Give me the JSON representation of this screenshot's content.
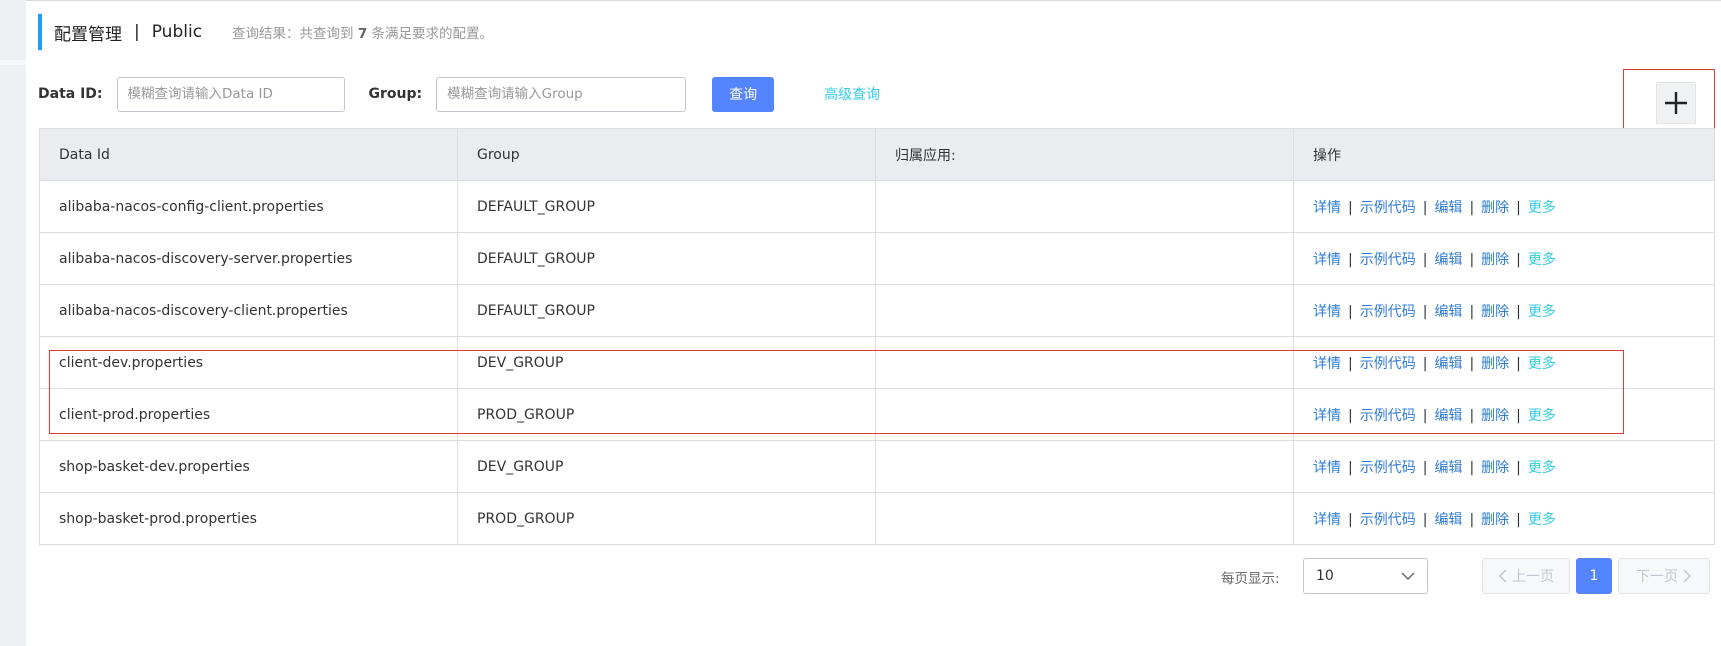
{
  "header": {
    "title": "配置管理",
    "separator": "|",
    "namespace": "Public",
    "result_prefix": "查询结果：共查询到",
    "result_count": "7",
    "result_suffix": "条满足要求的配置。"
  },
  "search": {
    "data_id_label": "Data ID:",
    "data_id_placeholder": "模糊查询请输入Data ID",
    "group_label": "Group:",
    "group_placeholder": "模糊查询请输入Group",
    "query_button": "查询",
    "advanced_query": "高级查询"
  },
  "add_button_icon": "plus-icon",
  "table": {
    "columns": [
      "Data Id",
      "Group",
      "归属应用:",
      "操作"
    ],
    "actions": [
      "详情",
      "示例代码",
      "编辑",
      "删除",
      "更多"
    ],
    "action_separator": "|",
    "rows": [
      {
        "data_id": "alibaba-nacos-config-client.properties",
        "group": "DEFAULT_GROUP",
        "app": ""
      },
      {
        "data_id": "alibaba-nacos-discovery-server.properties",
        "group": "DEFAULT_GROUP",
        "app": ""
      },
      {
        "data_id": "alibaba-nacos-discovery-client.properties",
        "group": "DEFAULT_GROUP",
        "app": ""
      },
      {
        "data_id": "client-dev.properties",
        "group": "DEV_GROUP",
        "app": ""
      },
      {
        "data_id": "client-prod.properties",
        "group": "PROD_GROUP",
        "app": ""
      },
      {
        "data_id": "shop-basket-dev.properties",
        "group": "DEV_GROUP",
        "app": ""
      },
      {
        "data_id": "shop-basket-prod.properties",
        "group": "PROD_GROUP",
        "app": ""
      }
    ]
  },
  "pagination": {
    "page_size_label": "每页显示:",
    "page_size": "10",
    "prev": "上一页",
    "current_page": "1",
    "next": "下一页"
  },
  "colors": {
    "accent": "#209bfa",
    "primary_button": "#5584ff",
    "link": "#2f7cd6",
    "link_secondary": "#33cde5",
    "highlight": "#e53935"
  }
}
